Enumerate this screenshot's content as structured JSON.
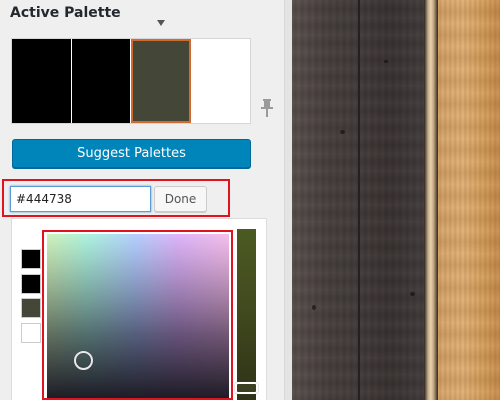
{
  "panel": {
    "title": "Active Palette"
  },
  "palette": {
    "swatches": [
      {
        "color": "#000000"
      },
      {
        "color": "#000000"
      },
      {
        "color": "#444738",
        "selected": true
      },
      {
        "color": "#ffffff"
      }
    ]
  },
  "suggest_button": {
    "label": "Suggest Palettes"
  },
  "color_input": {
    "value": "#444738",
    "done_label": "Done"
  },
  "picker": {
    "mini_swatches": [
      "#000000",
      "#000000",
      "#444738",
      "#ffffff"
    ]
  },
  "colors": {
    "accent_button": "#0085ba",
    "highlight_border": "#e0141e",
    "selected_swatch_outline": "#d06a2e"
  },
  "icons": {
    "caret": "caret-down-icon",
    "pin": "pin-icon"
  }
}
